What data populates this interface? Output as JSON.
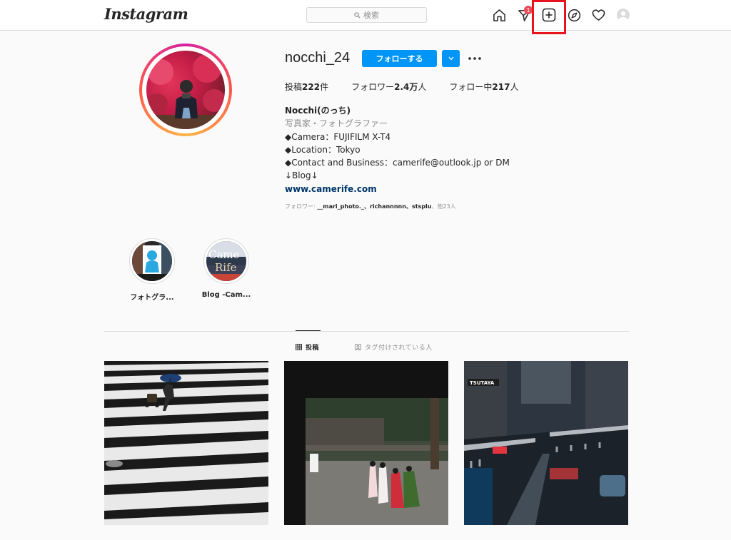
{
  "nav": {
    "logo": "Instagram",
    "search_placeholder": "検索",
    "notification_count": "1"
  },
  "profile": {
    "username": "nocchi_24",
    "follow_label": "フォローする",
    "stats": {
      "posts_label": "投稿",
      "posts_value": "222",
      "posts_unit": "件",
      "followers_label": "フォロワー",
      "followers_value": "2.4万",
      "followers_unit": "人",
      "following_label": "フォロー中",
      "following_value": "217",
      "following_unit": "人"
    },
    "bio": {
      "name": "Nocchi(のっち)",
      "category": "写真家・フォトグラファー",
      "lines": [
        "◆Camera：FUJIFILM X-T4",
        "◆Location：Tokyo",
        "◆Contact and Business：camerife@outlook.jp or DM",
        "↓Blog↓"
      ],
      "link": "www.camerife.com"
    },
    "followed_by": {
      "prefix": "フォロワー: ",
      "users": "__mari_photo._、richannnnn、stsplu",
      "suffix": "、他23人"
    }
  },
  "highlights": [
    {
      "label": "フォトグラ..."
    },
    {
      "label": "Blog -Cam..."
    }
  ],
  "tabs": {
    "posts": "投稿",
    "tagged": "タグ付けされている人"
  },
  "colors": {
    "follow_blue": "#0095f6",
    "highlight_red": "#e8141c",
    "badge_red": "#ed4956",
    "link_blue": "#00376b"
  }
}
